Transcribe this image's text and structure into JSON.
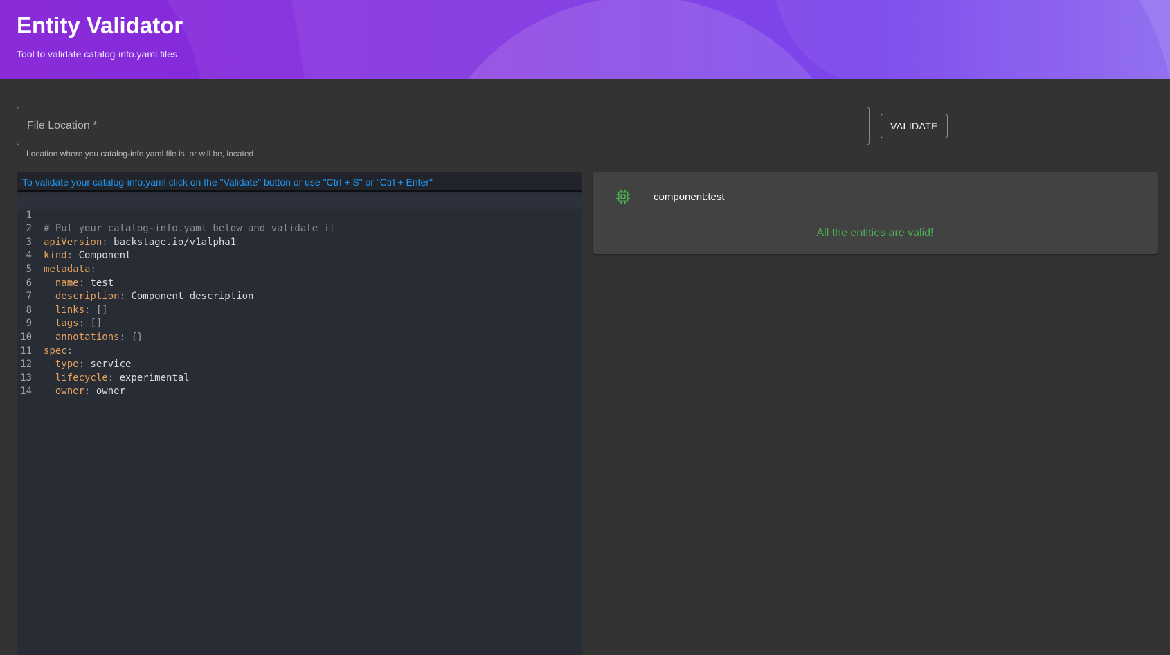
{
  "header": {
    "title": "Entity Validator",
    "subtitle": "Tool to validate catalog-info.yaml files"
  },
  "file_location": {
    "label": "File Location *",
    "value": "",
    "helper": "Location where you catalog-info.yaml file is, or will be, located"
  },
  "validate_button": {
    "label": "VALIDATE"
  },
  "editor": {
    "hint": "To validate your catalog-info.yaml click on the \"Validate\" button or use \"Ctrl + S\" or \"Ctrl + Enter\"",
    "lines": [
      {
        "number": "1",
        "indent": "",
        "comment": "# Put your catalog-info.yaml below and validate it"
      },
      {
        "number": "2",
        "indent": "",
        "key": "apiVersion",
        "value": "backstage.io/v1alpha1"
      },
      {
        "number": "3",
        "indent": "",
        "key": "kind",
        "value": "Component"
      },
      {
        "number": "4",
        "indent": "",
        "key": "metadata",
        "value": ""
      },
      {
        "number": "5",
        "indent": "  ",
        "key": "name",
        "value": "test"
      },
      {
        "number": "6",
        "indent": "  ",
        "key": "description",
        "value": "Component description"
      },
      {
        "number": "7",
        "indent": "  ",
        "key": "links",
        "punc_value": "[]"
      },
      {
        "number": "8",
        "indent": "  ",
        "key": "tags",
        "punc_value": "[]"
      },
      {
        "number": "9",
        "indent": "  ",
        "key": "annotations",
        "punc_value": "{}"
      },
      {
        "number": "10",
        "indent": "",
        "key": "spec",
        "value": ""
      },
      {
        "number": "11",
        "indent": "  ",
        "key": "type",
        "value": "service"
      },
      {
        "number": "12",
        "indent": "  ",
        "key": "lifecycle",
        "value": "experimental"
      },
      {
        "number": "13",
        "indent": "  ",
        "key": "owner",
        "value": "owner"
      },
      {
        "number": "14",
        "indent": ""
      }
    ]
  },
  "result": {
    "icon": "chip-icon",
    "entity_ref": "component:test",
    "status_message": "All the entities are valid!"
  },
  "colors": {
    "header_gradient_start": "#8a2bd8",
    "header_gradient_end": "#6a30ea",
    "hint_text": "#2196f3",
    "valid_text": "#4caf50",
    "yaml_key": "#e5a15e"
  }
}
